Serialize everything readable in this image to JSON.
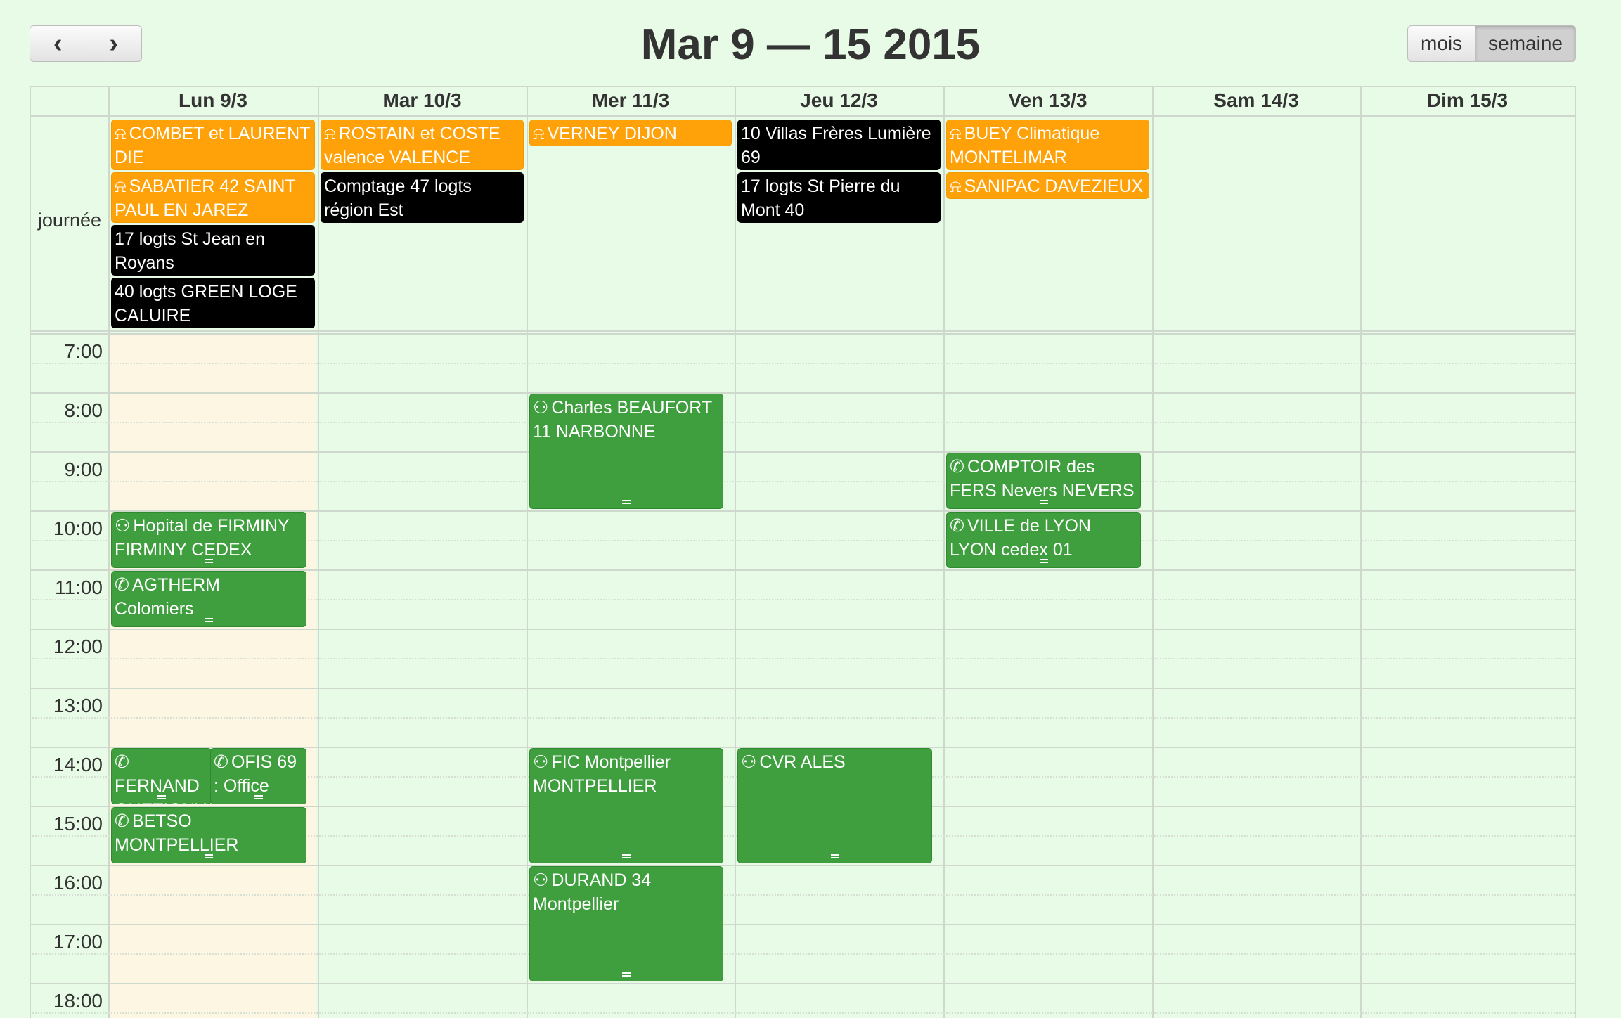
{
  "toolbar": {
    "prev_icon": "chevron-left-icon",
    "next_icon": "chevron-right-icon",
    "title": "Mar 9 — 15 2015",
    "views": [
      "mois",
      "semaine"
    ],
    "active_view": "semaine"
  },
  "days": [
    "Lun 9/3",
    "Mar 10/3",
    "Mer 11/3",
    "Jeu 12/3",
    "Ven 13/3",
    "Sam 14/3",
    "Dim 15/3"
  ],
  "allday_label": "journée",
  "times": [
    "7:00",
    "8:00",
    "9:00",
    "10:00",
    "11:00",
    "12:00",
    "13:00",
    "14:00",
    "15:00",
    "16:00",
    "17:00",
    "18:00"
  ],
  "allday_events": [
    {
      "day": 0,
      "text": "COMBET et LAURENT DIE",
      "color": "orange",
      "icon": "bell-icon"
    },
    {
      "day": 0,
      "text": "SABATIER 42 SAINT PAUL EN JAREZ",
      "color": "orange",
      "icon": "bell-icon"
    },
    {
      "day": 0,
      "text": "17 logts St Jean en Royans",
      "color": "black",
      "icon": ""
    },
    {
      "day": 0,
      "text": "40 logts GREEN LOGE CALUIRE",
      "color": "black",
      "icon": ""
    },
    {
      "day": 1,
      "text": "ROSTAIN et COSTE valence VALENCE",
      "color": "orange",
      "icon": "bell-icon"
    },
    {
      "day": 1,
      "text": "Comptage 47 logts région Est",
      "color": "black",
      "icon": ""
    },
    {
      "day": 2,
      "text": "VERNEY DIJON cedex",
      "color": "orange",
      "icon": "bell-icon"
    },
    {
      "day": 3,
      "text": "10 Villas Frères Lumière 69",
      "color": "black",
      "icon": ""
    },
    {
      "day": 3,
      "text": "17 logts St Pierre du Mont 40",
      "color": "black",
      "icon": ""
    },
    {
      "day": 4,
      "text": "BUEY Climatique MONTELIMAR",
      "color": "orange",
      "icon": "bell-icon"
    },
    {
      "day": 4,
      "text": "SANIPAC DAVEZIEUX",
      "color": "orange",
      "icon": "bell-icon"
    }
  ],
  "timed_events": [
    {
      "day": 2,
      "text": "Charles BEAUFORT 11 NARBONNE",
      "icon": "users-icon",
      "start": "8:00",
      "end": "10:00"
    },
    {
      "day": 4,
      "text": "COMPTOIR des FERS Nevers NEVERS",
      "icon": "phone-icon",
      "start": "9:00",
      "end": "10:00"
    },
    {
      "day": 0,
      "text": "Hopital de FIRMINY FIRMINY CEDEX",
      "icon": "users-icon",
      "start": "10:00",
      "end": "11:00"
    },
    {
      "day": 4,
      "text": "VILLE de LYON LYON cedex 01",
      "icon": "phone-icon",
      "start": "10:00",
      "end": "11:00"
    },
    {
      "day": 0,
      "text": "AGTHERM Colomiers",
      "icon": "phone-icon",
      "start": "11:00",
      "end": "12:00"
    },
    {
      "day": 0,
      "text": "FERNAND QUETIGNY",
      "icon": "phone-icon",
      "start": "14:00",
      "end": "15:00"
    },
    {
      "day": 0,
      "text": "OFIS 69 : Office",
      "icon": "phone-icon",
      "start": "14:00",
      "end": "15:00"
    },
    {
      "day": 0,
      "text": "BETSO MONTPELLIER",
      "icon": "phone-icon",
      "start": "15:00",
      "end": "16:00"
    },
    {
      "day": 2,
      "text": "FIC Montpellier MONTPELLIER",
      "icon": "users-icon",
      "start": "14:00",
      "end": "16:00"
    },
    {
      "day": 3,
      "text": "CVR ALES",
      "icon": "users-icon",
      "start": "14:00",
      "end": "16:00"
    },
    {
      "day": 2,
      "text": "DURAND 34 Montpellier",
      "icon": "users-icon",
      "start": "16:00",
      "end": "18:00"
    }
  ]
}
